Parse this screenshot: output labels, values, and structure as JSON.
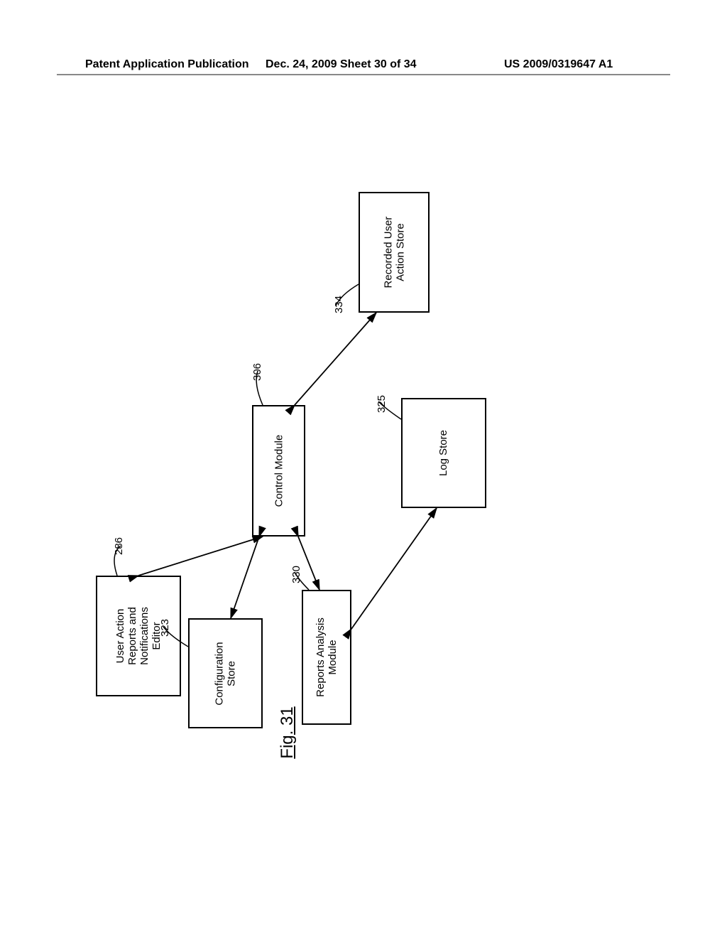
{
  "header": {
    "left": "Patent Application Publication",
    "mid": "Dec. 24, 2009  Sheet 30 of 34",
    "right": "US 2009/0319647 A1"
  },
  "figure": {
    "title": "Fig. 31",
    "boxes": {
      "editor": {
        "label": "User Action\nReports and\nNotifications\nEditor",
        "ref": "286"
      },
      "control": {
        "label": "Control Module",
        "ref": "306"
      },
      "recorded": {
        "label": "Recorded User\nAction Store",
        "ref": "334"
      },
      "config": {
        "label": "Configuration\nStore",
        "ref": "323"
      },
      "analysis": {
        "label": "Reports Analysis\nModule",
        "ref": "330"
      },
      "log": {
        "label": "Log Store",
        "ref": "325"
      }
    }
  }
}
